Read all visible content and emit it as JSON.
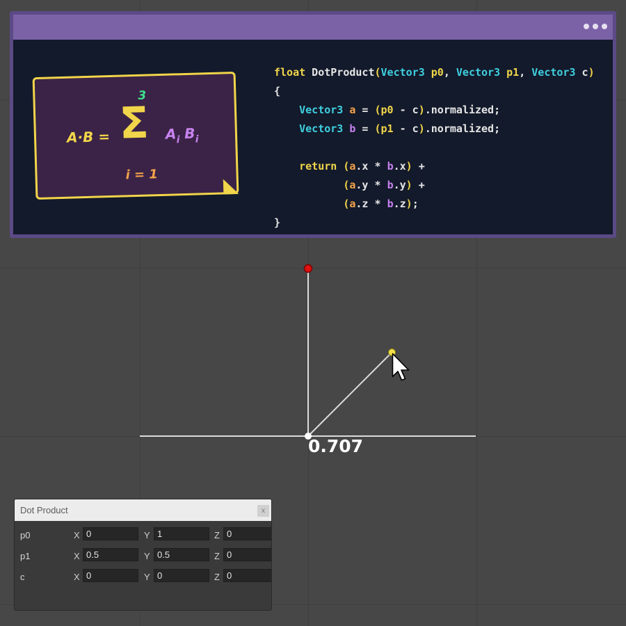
{
  "card": {
    "menu_icon": "more-horizontal-icon",
    "formula": {
      "lhs": "A·B =",
      "sigma": "Σ",
      "upper": "3",
      "lower": "i = 1",
      "rhs_a": "A",
      "rhs_b": "B",
      "sub": "i"
    },
    "code_lines": [
      "float DotProduct(Vector3 p0, Vector3 p1, Vector3 c)",
      "{",
      "    Vector3 a = (p0 - c).normalized;",
      "    Vector3 b = (p1 - c).normalized;",
      "",
      "    return (a.x * b.x) +",
      "           (a.y * b.y) +",
      "           (a.z * b.z);",
      "}"
    ]
  },
  "scene": {
    "dot_product_value": "0.707",
    "points": {
      "p0": {
        "x": 0,
        "y": 1
      },
      "p1": {
        "x": 0.5,
        "y": 0.5
      },
      "c": {
        "x": 0,
        "y": 0
      }
    },
    "colors": {
      "p0": "#e01010",
      "p1": "#f2e14a",
      "c": "#ffffff",
      "axes": "#dcdcdc"
    }
  },
  "panel": {
    "title": "Dot Product",
    "close_label": "x",
    "rows": [
      {
        "label": "p0",
        "x_label": "X",
        "x": "0",
        "y_label": "Y",
        "y": "1",
        "z_label": "Z",
        "z": "0"
      },
      {
        "label": "p1",
        "x_label": "X",
        "x": "0.5",
        "y_label": "Y",
        "y": "0.5",
        "z_label": "Z",
        "z": "0"
      },
      {
        "label": "c",
        "x_label": "X",
        "x": "0",
        "y_label": "Y",
        "y": "0",
        "z_label": "Z",
        "z": "0"
      }
    ]
  }
}
